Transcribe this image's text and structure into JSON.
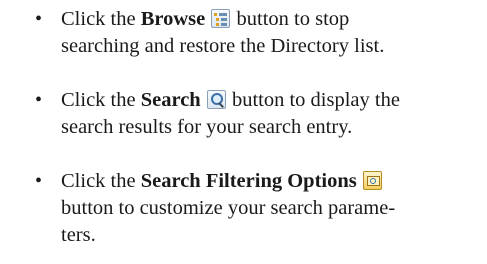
{
  "bullets": [
    {
      "symbol": "•",
      "prefix": "Click the ",
      "term": "Browse",
      "icon": "browse-icon",
      "line1_rest": " button to stop",
      "line2": "searching and restore the Directory list."
    },
    {
      "symbol": "•",
      "prefix": "Click the ",
      "term": "Search",
      "icon": "search-icon",
      "line1_rest": " button to display the",
      "line2": "search results for your search entry."
    },
    {
      "symbol": "•",
      "prefix": "Click the ",
      "term": "Search Filtering Options",
      "icon": "search-filter-icon",
      "line1_rest": "",
      "line2": "button to customize your search parame-",
      "line3": "ters."
    }
  ]
}
